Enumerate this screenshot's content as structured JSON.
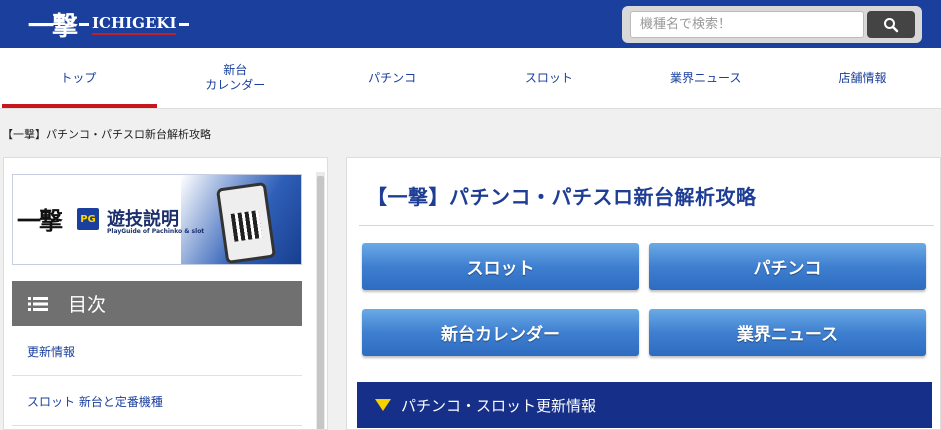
{
  "header": {
    "logo_kanji": "一撃",
    "logo_word": "ICHIGEKI",
    "search_placeholder": "機種名で検索！",
    "search_icon": "search-icon"
  },
  "nav": {
    "items": [
      {
        "label": "トップ",
        "active": true
      },
      {
        "label": "新台\nカレンダー"
      },
      {
        "label": "パチンコ"
      },
      {
        "label": "スロット"
      },
      {
        "label": "業界ニュース"
      },
      {
        "label": "店舗情報"
      }
    ]
  },
  "breadcrumb": "【一撃】パチンコ・パチスロ新台解析攻略",
  "sidebar": {
    "banner": {
      "kanji": "一撃",
      "badge": "PG",
      "title": "遊技説明",
      "subtitle": "PlayGuide of Pachinko & slot"
    },
    "toc_label": "目次",
    "toc_icon": "list-icon",
    "links": [
      "更新情報",
      "スロット 新台と定番機種"
    ]
  },
  "main": {
    "title": "【一撃】パチンコ・パチスロ新台解析攻略",
    "buttons": [
      "スロット",
      "パチンコ",
      "新台カレンダー",
      "業界ニュース"
    ],
    "section_head": "パチンコ・スロット更新情報",
    "section_icon": "triangle-down-icon"
  },
  "colors": {
    "header_bg": "#1a3f9c",
    "accent_red": "#c8161d",
    "button_blue": "#3f7fd0",
    "section_bg": "#16308a"
  }
}
